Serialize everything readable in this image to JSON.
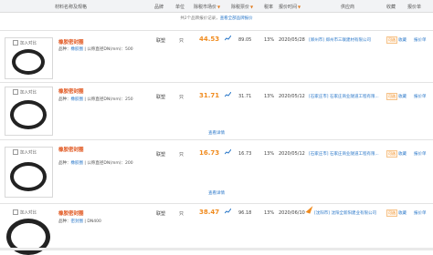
{
  "header": {
    "name": "材料名称及规格",
    "brand": "品牌",
    "unit": "单位",
    "market_price": "除税市场价",
    "tax_price": "除税票价",
    "tax_rate": "税率",
    "date": "报价时间",
    "supplier": "供应商",
    "fav": "收藏",
    "report": "报价单",
    "sort_icon": "▼"
  },
  "note": {
    "text": "共2个品牌报价记录，",
    "link": "查看全部品牌报价"
  },
  "compare_label": "加入对比",
  "product_name": "橡胶密封圈",
  "brand_label": "品种：",
  "brand_value": "橡胶圈",
  "rows": [
    {
      "spec": "公称直径DN(mm)：500",
      "brand": "联塑",
      "unit": "只",
      "price": "44.53",
      "tax_price": "89.05",
      "rate": "13%",
      "date": "2020/05/28",
      "supplier": "[郑州市] 郑州市三联建材有限公司",
      "badge": "可选",
      "fav": "收藏",
      "report": "报价单",
      "detail": ""
    },
    {
      "spec": "公称直径DN(mm)：250",
      "brand": "联塑",
      "unit": "只",
      "price": "31.71",
      "tax_price": "31.71",
      "rate": "13%",
      "date": "2020/05/12",
      "supplier": "[石家庄市] 石家庄商业隧道工程有限...",
      "badge": "可选",
      "fav": "收藏",
      "report": "报价单",
      "detail": "查看详情"
    },
    {
      "spec": "公称直径DN(mm)：200",
      "brand": "联塑",
      "unit": "只",
      "price": "16.73",
      "tax_price": "16.73",
      "rate": "13%",
      "date": "2020/05/12",
      "supplier": "[石家庄市] 石家庄商业隧道工程有限...",
      "badge": "可选",
      "fav": "收藏",
      "report": "报价单",
      "detail": "查看详情"
    },
    {
      "spec": "DN400",
      "brand": "联塑",
      "unit": "只",
      "price": "38.47",
      "tax_price": "96.18",
      "rate": "13%",
      "date": "2020/06/10",
      "supplier": "[沈阳市] 沈阳全新阳建业有限公司",
      "badge": "可选",
      "fav": "收藏",
      "report": "报价单",
      "detail": "",
      "brand_value": "密封圈"
    }
  ]
}
